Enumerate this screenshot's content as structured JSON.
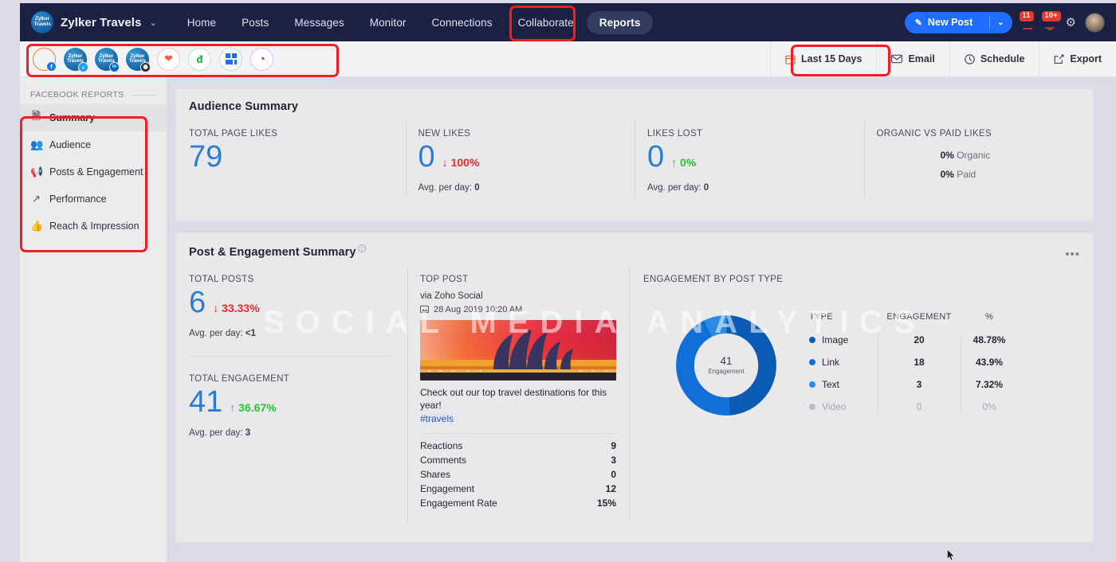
{
  "topnav": {
    "brand": {
      "logo_line1": "Zylker",
      "logo_line2": "Travels",
      "name": "Zylker Travels",
      "caret": "⌄"
    },
    "links": [
      "Home",
      "Posts",
      "Messages",
      "Monitor",
      "Connections",
      "Collaborate",
      "Reports"
    ],
    "active_link": "Reports",
    "new_post_label": "New Post",
    "badges": [
      "11",
      "10+"
    ],
    "icons": {
      "gear": "⚙",
      "pencil": "✎",
      "caret": "⌄"
    },
    "colors": {
      "bar": "#1b2142",
      "accent": "#1f6dff",
      "badge": "#e23b2e",
      "active_tab": "#343b61"
    }
  },
  "channelbar": {
    "channels": [
      {
        "name": "facebook",
        "badge": "f",
        "badge_color": "#1877f2",
        "style": "ring",
        "selected": true
      },
      {
        "name": "twitter",
        "badge": "ᵥ",
        "badge_color": "#1da1f2",
        "style": "avatar",
        "av1": "Zylker",
        "av2": "Travels"
      },
      {
        "name": "linkedin",
        "badge": "in",
        "badge_color": "#0a66c2",
        "style": "avatar",
        "av1": "Zylker",
        "av2": "Travels"
      },
      {
        "name": "instagram",
        "badge": "◉",
        "badge_color": "#2b2b2b",
        "style": "avatar",
        "av1": "Zylker",
        "av2": "Travels"
      },
      {
        "name": "google-business",
        "style": "plain",
        "glyph": "❤",
        "glyph_color": "#f2613f"
      },
      {
        "name": "zoho-desk",
        "style": "plain",
        "glyph": "đ",
        "glyph_color": "#10a54a"
      },
      {
        "name": "zoho-crm",
        "style": "plain",
        "glyph": "█",
        "glyph_color": "#1f6dff"
      },
      {
        "name": "tiktok",
        "style": "plain",
        "glyph": "◔",
        "glyph_color": "#9b2fe0"
      }
    ],
    "actions": [
      {
        "label": "Last 15 Days",
        "icon": "calendar-icon"
      },
      {
        "label": "Email",
        "icon": "envelope-icon"
      },
      {
        "label": "Schedule",
        "icon": "clock-icon"
      },
      {
        "label": "Export",
        "icon": "export-icon"
      }
    ]
  },
  "sidebar": {
    "heading": "FACEBOOK REPORTS",
    "items": [
      {
        "label": "Summary",
        "icon": "🗎",
        "active": true
      },
      {
        "label": "Audience",
        "icon": "👥",
        "active": false
      },
      {
        "label": "Posts & Engagement",
        "icon": "📢",
        "active": false
      },
      {
        "label": "Performance",
        "icon": "↗",
        "active": false
      },
      {
        "label": "Reach & Impression",
        "icon": "👍",
        "active": false
      }
    ]
  },
  "audience_summary": {
    "title": "Audience Summary",
    "metrics": [
      {
        "label": "TOTAL PAGE LIKES",
        "value": "79",
        "delta": "",
        "delta_dir": "",
        "sub_label": "",
        "sub_value": ""
      },
      {
        "label": "NEW LIKES",
        "value": "0",
        "delta": "100%",
        "delta_dir": "down",
        "sub_label": "Avg. per day:",
        "sub_value": "0"
      },
      {
        "label": "LIKES LOST",
        "value": "0",
        "delta": "0%",
        "delta_dir": "up",
        "sub_label": "Avg. per day:",
        "sub_value": "0"
      }
    ],
    "organic_paid": {
      "label": "ORGANIC VS PAID LIKES",
      "organic_pct": "0%",
      "organic_label": "Organic",
      "paid_pct": "0%",
      "paid_label": "Paid"
    }
  },
  "post_summary": {
    "title": "Post & Engagement Summary",
    "total_posts": {
      "label": "TOTAL POSTS",
      "value": "6",
      "delta": "33.33%",
      "delta_dir": "down",
      "sub_label": "Avg. per day:",
      "sub_value": "<1"
    },
    "total_engagement": {
      "label": "TOTAL ENGAGEMENT",
      "value": "41",
      "delta": "36.67%",
      "delta_dir": "up",
      "sub_label": "Avg. per day:",
      "sub_value": "3"
    },
    "top_post": {
      "label": "TOP POST",
      "via": "via Zoho Social",
      "date": "28 Aug 2019 10:20 AM",
      "text": "Check out our top travel destinations for this year!",
      "hashtag": "#travels",
      "stats": [
        {
          "name": "Reactions",
          "value": "9"
        },
        {
          "name": "Comments",
          "value": "3"
        },
        {
          "name": "Shares",
          "value": "0"
        },
        {
          "name": "Engagement",
          "value": "12"
        },
        {
          "name": "Engagement Rate",
          "value": "15%"
        }
      ]
    },
    "engagement_by_type": {
      "label": "ENGAGEMENT BY POST TYPE",
      "center_value": "41",
      "center_caption": "Engagement",
      "headers": [
        "TYPE",
        "ENGAGEMENT",
        "%"
      ]
    }
  },
  "chart_data": {
    "type": "pie",
    "title": "ENGAGEMENT BY POST TYPE",
    "center_value": 41,
    "center_label": "Engagement",
    "categories": [
      "Image",
      "Link",
      "Text",
      "Video"
    ],
    "values": [
      20,
      18,
      3,
      0
    ],
    "percentages": [
      "48.78%",
      "43.9%",
      "7.32%",
      "0%"
    ],
    "colors": [
      "#0a5bb5",
      "#1170d8",
      "#2b8ae8",
      "#b9bcc4"
    ],
    "legend_position": "right",
    "legend_columns": [
      "TYPE",
      "ENGAGEMENT",
      "%"
    ]
  },
  "watermark": "SOCIAL MEDIA ANALYTICS"
}
